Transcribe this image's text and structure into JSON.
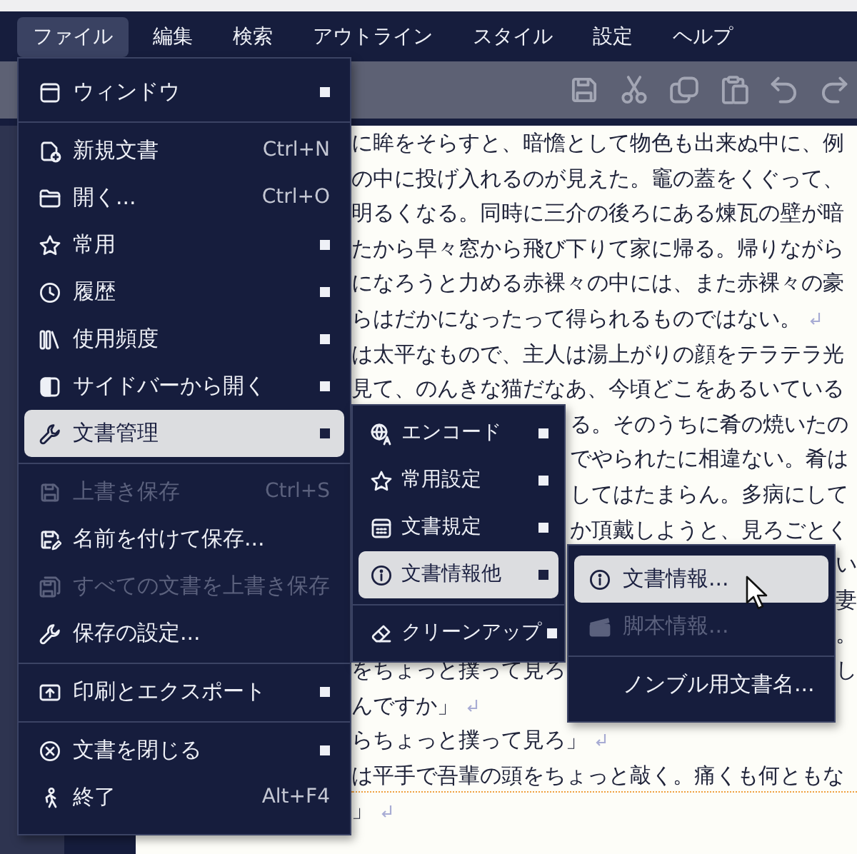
{
  "menubar": [
    {
      "label": "ファイル",
      "selected": true
    },
    {
      "label": "編集",
      "selected": false
    },
    {
      "label": "検索",
      "selected": false
    },
    {
      "label": "アウトライン",
      "selected": false
    },
    {
      "label": "スタイル",
      "selected": false
    },
    {
      "label": "設定",
      "selected": false
    },
    {
      "label": "ヘルプ",
      "selected": false
    }
  ],
  "file_menu": {
    "items": [
      {
        "kind": "item",
        "label": "ウィンドウ",
        "submenu": true,
        "selected": false,
        "disabled": false
      },
      {
        "kind": "separator"
      },
      {
        "kind": "item",
        "label": "新規文書",
        "shortcut": "Ctrl+N",
        "submenu": false,
        "selected": false,
        "disabled": false
      },
      {
        "kind": "item",
        "label": "開く...",
        "shortcut": "Ctrl+O",
        "submenu": false,
        "selected": false,
        "disabled": false
      },
      {
        "kind": "item",
        "label": "常用",
        "submenu": true,
        "selected": false,
        "disabled": false
      },
      {
        "kind": "item",
        "label": "履歴",
        "submenu": true,
        "selected": false,
        "disabled": false
      },
      {
        "kind": "item",
        "label": "使用頻度",
        "submenu": true,
        "selected": false,
        "disabled": false
      },
      {
        "kind": "item",
        "label": "サイドバーから開く",
        "submenu": true,
        "selected": false,
        "disabled": false
      },
      {
        "kind": "item",
        "label": "文書管理",
        "submenu": true,
        "selected": true,
        "disabled": false
      },
      {
        "kind": "separator"
      },
      {
        "kind": "item",
        "label": "上書き保存",
        "shortcut": "Ctrl+S",
        "submenu": false,
        "selected": false,
        "disabled": true
      },
      {
        "kind": "item",
        "label": "名前を付けて保存...",
        "submenu": false,
        "selected": false,
        "disabled": false
      },
      {
        "kind": "item",
        "label": "すべての文書を上書き保存",
        "submenu": false,
        "selected": false,
        "disabled": true
      },
      {
        "kind": "item",
        "label": "保存の設定...",
        "submenu": false,
        "selected": false,
        "disabled": false
      },
      {
        "kind": "separator"
      },
      {
        "kind": "item",
        "label": "印刷とエクスポート",
        "submenu": true,
        "selected": false,
        "disabled": false
      },
      {
        "kind": "separator"
      },
      {
        "kind": "item",
        "label": "文書を閉じる",
        "submenu": true,
        "selected": false,
        "disabled": false
      },
      {
        "kind": "item",
        "label": "終了",
        "shortcut": "Alt+F4",
        "submenu": false,
        "selected": false,
        "disabled": false
      }
    ]
  },
  "document_submenu": {
    "items": [
      {
        "kind": "item",
        "label": "エンコード",
        "submenu": true,
        "selected": false,
        "disabled": false
      },
      {
        "kind": "item",
        "label": "常用設定",
        "submenu": true,
        "selected": false,
        "disabled": false
      },
      {
        "kind": "item",
        "label": "文書規定",
        "submenu": true,
        "selected": false,
        "disabled": false
      },
      {
        "kind": "item",
        "label": "文書情報他",
        "submenu": true,
        "selected": true,
        "disabled": false
      },
      {
        "kind": "separator"
      },
      {
        "kind": "item",
        "label": "クリーンアップ",
        "submenu": true,
        "selected": false,
        "disabled": false
      }
    ]
  },
  "info_submenu": {
    "items": [
      {
        "kind": "item",
        "label": "文書情報...",
        "submenu": false,
        "selected": true,
        "disabled": false
      },
      {
        "kind": "item",
        "label": "脚本情報...",
        "submenu": false,
        "selected": false,
        "disabled": true
      },
      {
        "kind": "separator"
      },
      {
        "kind": "item",
        "label": "ノンブル用文書名...",
        "submenu": false,
        "selected": false,
        "disabled": false
      }
    ]
  },
  "editor": {
    "lines": [
      {
        "segments": [
          {
            "kind": "full",
            "text": "に眸をそらすと、暗憺として物色も出来ぬ中に、例"
          }
        ],
        "eol_mark": false,
        "current": false
      },
      {
        "segments": [
          {
            "kind": "full",
            "text": "の中に投げ入れるのが見えた。竈の蓋をくぐって、"
          }
        ],
        "eol_mark": false,
        "current": false
      },
      {
        "segments": [
          {
            "kind": "full",
            "text": "明るくなる。同時に三介の後ろにある煉瓦の壁が暗"
          }
        ],
        "eol_mark": false,
        "current": false
      },
      {
        "segments": [
          {
            "kind": "full",
            "text": "たから早々窓から飛び下りて家に帰る。帰りながら"
          }
        ],
        "eol_mark": false,
        "current": false
      },
      {
        "segments": [
          {
            "kind": "full",
            "text": "になろうと力める赤裸々の中には、また赤裸々の豪"
          }
        ],
        "eol_mark": false,
        "current": false
      },
      {
        "segments": [
          {
            "kind": "full",
            "text": "らはだかになったって得られるものではない。"
          }
        ],
        "eol_mark": true,
        "current": false
      },
      {
        "segments": [
          {
            "kind": "full",
            "text": "は太平なもので、主人は湯上がりの顔をテラテラ光"
          }
        ],
        "eol_mark": false,
        "current": false
      },
      {
        "segments": [
          {
            "kind": "full",
            "text": "見て、のんきな猫だなあ、今頃どこをあるいている"
          }
        ],
        "eol_mark": false,
        "current": false
      },
      {
        "segments": [
          {
            "kind": "middle",
            "text": "る。そのうちに肴の焼いたの"
          }
        ],
        "eol_mark": false,
        "current": false
      },
      {
        "segments": [
          {
            "kind": "middle",
            "text": "でやられたに相違ない。肴は"
          }
        ],
        "eol_mark": false,
        "current": false
      },
      {
        "segments": [
          {
            "kind": "middle",
            "text": "してはたまらん。多病にして"
          }
        ],
        "eol_mark": false,
        "current": false
      },
      {
        "segments": [
          {
            "kind": "middle",
            "text": "か頂戴しようと、見ろごとく"
          }
        ],
        "eol_mark": false,
        "current": false
      },
      {
        "segments": [
          {
            "kind": "tail",
            "text": "い"
          }
        ],
        "eol_mark": false,
        "current": false
      },
      {
        "segments": [
          {
            "kind": "tail",
            "text": "妻"
          }
        ],
        "eol_mark": false,
        "current": false
      },
      {
        "segments": [
          {
            "kind": "tail",
            "text": "。"
          }
        ],
        "eol_mark": false,
        "current": false
      },
      {
        "segments": [
          {
            "kind": "left",
            "text": "をちょっと撲って見ろ"
          },
          {
            "kind": "tail",
            "text": "し"
          }
        ],
        "eol_mark": false,
        "current": false
      },
      {
        "segments": [
          {
            "kind": "full",
            "text": "んですか」"
          }
        ],
        "eol_mark": true,
        "current": false
      },
      {
        "segments": [
          {
            "kind": "full",
            "text": "らちょっと撲って見ろ」"
          }
        ],
        "eol_mark": true,
        "current": false
      },
      {
        "segments": [
          {
            "kind": "full",
            "text": "は平手で吾輩の頭をちょっと敲く。痛くも何ともな"
          }
        ],
        "eol_mark": false,
        "current": true
      },
      {
        "segments": [
          {
            "kind": "full",
            "text": "」"
          }
        ],
        "eol_mark": true,
        "current": false
      }
    ]
  }
}
